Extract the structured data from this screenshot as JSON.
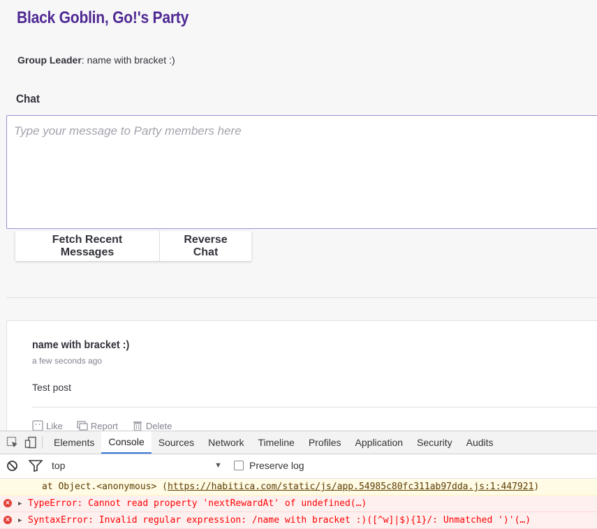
{
  "party": {
    "title": "Black Goblin, Go!'s Party",
    "leader_label": "Group Leader",
    "leader_name": ": name with bracket :)"
  },
  "chat": {
    "heading": "Chat",
    "input_placeholder": "Type your message to Party members here",
    "fetch_label": "Fetch Recent Messages",
    "reverse_label": "Reverse Chat"
  },
  "message": {
    "author": "name with bracket :)",
    "time": "a few seconds ago",
    "text": "Test post",
    "actions": [
      "Like",
      "Report",
      "Delete"
    ]
  },
  "devtools": {
    "tabs": [
      "Elements",
      "Console",
      "Sources",
      "Network",
      "Timeline",
      "Profiles",
      "Application",
      "Security",
      "Audits"
    ],
    "active_tab": "Console",
    "context": "top",
    "preserve_log_label": "Preserve log",
    "logs": [
      {
        "type": "warn",
        "prefix": "at Object.<anonymous> (",
        "link": "https://habitica.com/static/js/app.54985c80fc311ab97dda.js:1:447921",
        "suffix": ")"
      },
      {
        "type": "error",
        "text": "TypeError: Cannot read property 'nextRewardAt' of undefined(…)"
      },
      {
        "type": "error",
        "text": "SyntaxError: Invalid regular expression: /name with bracket :)([^w]|$){1}/: Unmatched ')'(…)"
      }
    ]
  },
  "colors": {
    "brand_purple": "#4f2a93",
    "input_border": "#9a8ed1",
    "error_red": "#ff0000",
    "active_tab": "#3879d9"
  }
}
